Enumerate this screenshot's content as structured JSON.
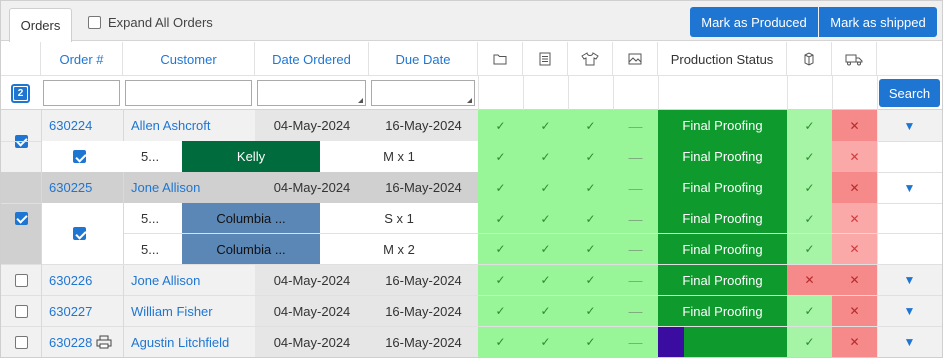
{
  "toolbar": {
    "tab_label": "Orders",
    "expand_label": "Expand All Orders",
    "produced_label": "Mark as Produced",
    "shipped_label": "Mark as shipped"
  },
  "columns": {
    "order": "Order #",
    "customer": "Customer",
    "date_ordered": "Date Ordered",
    "due_date": "Due Date",
    "production_status": "Production Status",
    "icons": [
      "folder-icon",
      "document-icon",
      "tshirt-icon",
      "image-icon",
      "box-icon",
      "truck-icon"
    ]
  },
  "filter": {
    "selected_count": "2",
    "search_label": "Search"
  },
  "colors": {
    "accent": "#1f76d2",
    "status_done": "#98f598",
    "status_error": "#fba8a8",
    "production": "#0f9a2e",
    "kelly": "#006b3c",
    "columbia": "#5b87b7",
    "purple": "#3a0da0"
  },
  "orders": [
    {
      "order": "630224",
      "customer": "Allen Ashcroft",
      "date_ordered": "04-May-2024",
      "due_date": "16-May-2024",
      "status": "Final Proofing",
      "checked": true
    },
    {
      "order": "630225",
      "customer": "Jone Allison",
      "date_ordered": "04-May-2024",
      "due_date": "16-May-2024",
      "status": "Final Proofing",
      "checked": true
    },
    {
      "order": "630226",
      "customer": "Jone Allison",
      "date_ordered": "04-May-2024",
      "due_date": "16-May-2024",
      "status": "Final Proofing",
      "checked": false
    },
    {
      "order": "630227",
      "customer": "William Fisher",
      "date_ordered": "04-May-2024",
      "due_date": "16-May-2024",
      "status": "Final Proofing",
      "checked": false
    },
    {
      "order": "630228",
      "customer": "Agustin Litchfield",
      "date_ordered": "04-May-2024",
      "due_date": "16-May-2024",
      "status": "",
      "checked": false
    }
  ],
  "items": [
    {
      "code": "5...",
      "color": "Kelly",
      "size": "M x 1",
      "status": "Final Proofing"
    },
    {
      "code": "5...",
      "color": "Columbia ...",
      "size": "S x 1",
      "status": "Final Proofing"
    },
    {
      "code": "5...",
      "color": "Columbia ...",
      "size": "M x 2",
      "status": "Final Proofing"
    }
  ]
}
